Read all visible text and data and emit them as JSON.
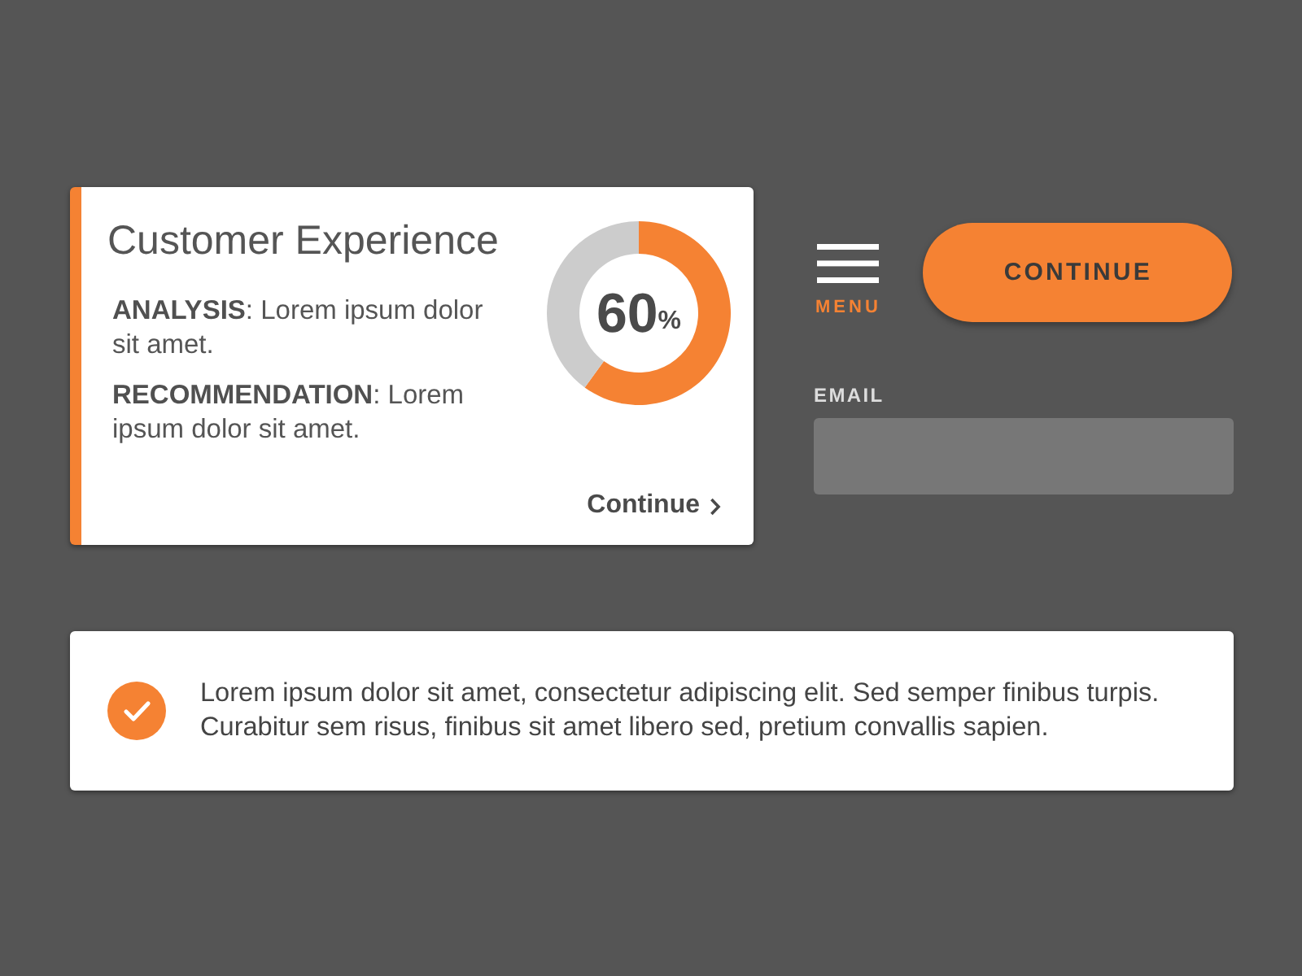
{
  "insight_card": {
    "title": "Customer Experience",
    "paragraphs": [
      "**ANALYSIS**: Lorem ipsum dolor sit amet.",
      "**RECOMMENDATION**: Lorem ipsum dolor sit amet."
    ],
    "progress": {
      "value": "60",
      "unit": "%",
      "chart_data": {
        "type": "donut",
        "values": [
          60,
          40
        ]
      }
    },
    "link": "Continue"
  },
  "menu": {
    "label": "MENU"
  },
  "primary_button": {
    "label": "CONTINUE"
  },
  "email_field": {
    "label": "EMAIL"
  },
  "notice": {
    "text": "Lorem ipsum dolor sit amet, consectetur adipiscing elit. Sed semper finibus turpis. Curabitur sem risus, finibus sit amet libero sed, pretium convallis sapien."
  }
}
